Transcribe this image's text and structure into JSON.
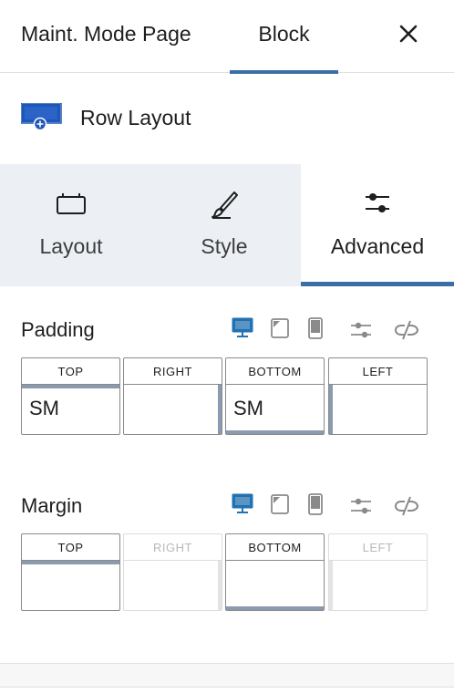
{
  "header": {
    "tab_document": "Maint. Mode Page",
    "tab_block": "Block"
  },
  "block": {
    "name": "Row Layout",
    "icon": "row-layout-icon"
  },
  "subtabs": [
    {
      "label": "Layout",
      "icon": "layout-icon"
    },
    {
      "label": "Style",
      "icon": "brush-icon"
    },
    {
      "label": "Advanced",
      "icon": "sliders-icon",
      "active": true
    }
  ],
  "padding": {
    "title": "Padding",
    "fields": [
      {
        "label": "TOP",
        "value": "SM"
      },
      {
        "label": "RIGHT",
        "value": ""
      },
      {
        "label": "BOTTOM",
        "value": "SM"
      },
      {
        "label": "LEFT",
        "value": ""
      }
    ]
  },
  "margin": {
    "title": "Margin",
    "fields": [
      {
        "label": "TOP",
        "value": ""
      },
      {
        "label": "RIGHT",
        "value": "",
        "disabled": true
      },
      {
        "label": "BOTTOM",
        "value": ""
      },
      {
        "label": "LEFT",
        "value": "",
        "disabled": true
      }
    ]
  },
  "device_icons": [
    "desktop-icon",
    "tablet-icon",
    "mobile-icon",
    "custom-settings-icon",
    "unlink-icon"
  ],
  "colors": {
    "accent": "#3a6fa5",
    "subtab_bg": "#ecf0f4",
    "border": "#8a8a8a",
    "bar": "#8a9bb0"
  }
}
